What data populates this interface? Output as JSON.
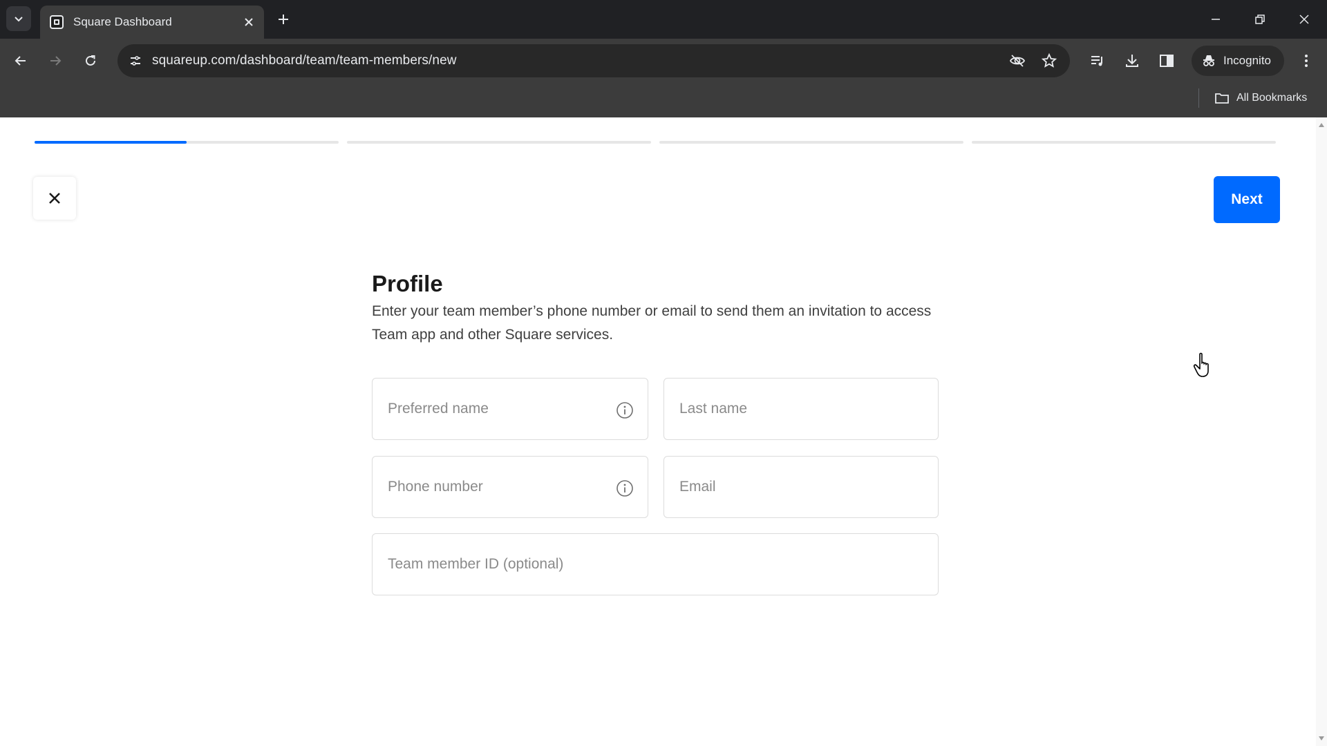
{
  "browser": {
    "tab_title": "Square Dashboard",
    "url": "squareup.com/dashboard/team/team-members/new",
    "incognito_label": "Incognito",
    "bookmarks_label": "All Bookmarks"
  },
  "wizard": {
    "steps": [
      {
        "name": "step-1",
        "progress": 0.5
      },
      {
        "name": "step-2",
        "progress": 0
      },
      {
        "name": "step-3",
        "progress": 0
      },
      {
        "name": "step-4",
        "progress": 0
      }
    ],
    "next_label": "Next"
  },
  "profile": {
    "title": "Profile",
    "description": "Enter your team member’s phone number or email to send them an invitation to access Team app and other Square services.",
    "fields": {
      "preferred_name": "Preferred name",
      "last_name": "Last name",
      "phone_number": "Phone number",
      "email": "Email",
      "team_member_id": "Team member ID (optional)"
    }
  },
  "colors": {
    "accent": "#006aff",
    "chrome_dark": "#202124",
    "chrome_toolbar": "#3c3c3c"
  }
}
